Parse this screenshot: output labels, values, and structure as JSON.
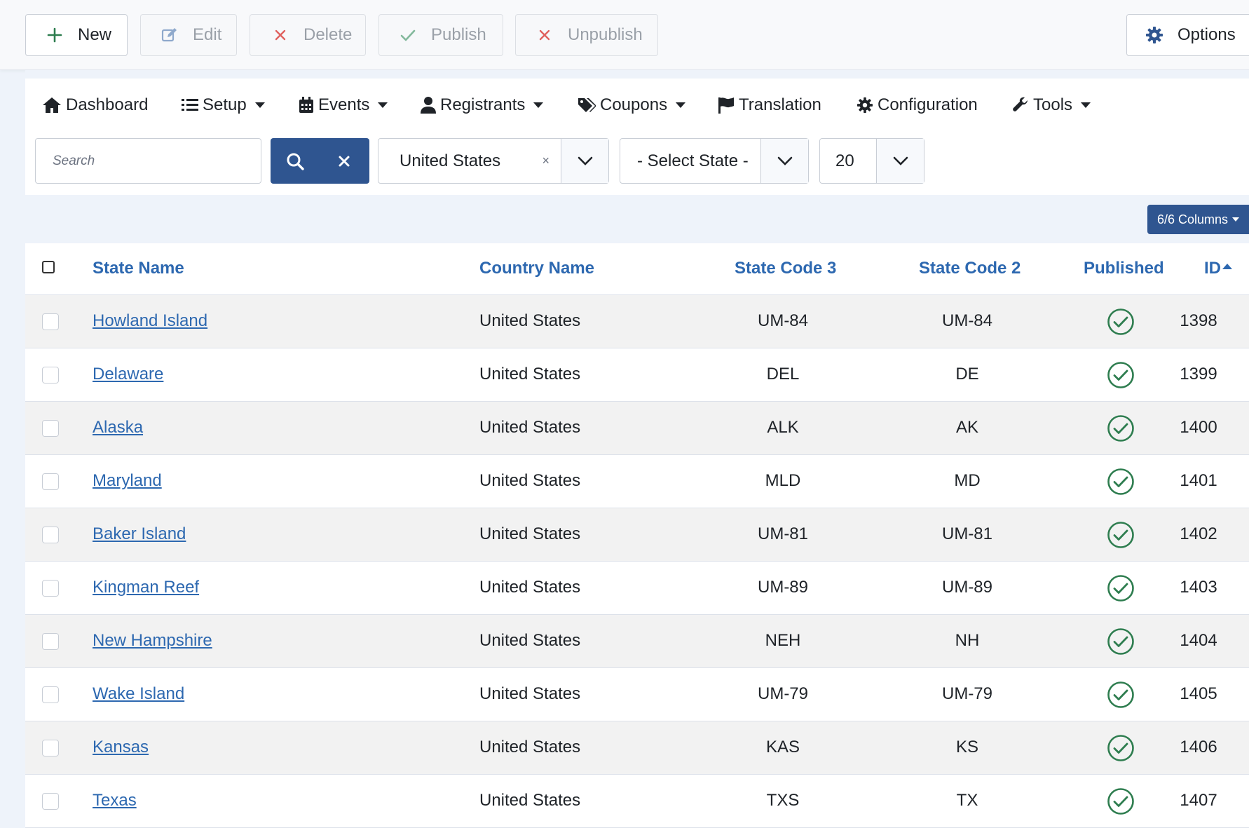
{
  "toolbar": {
    "new_label": "New",
    "edit_label": "Edit",
    "delete_label": "Delete",
    "publish_label": "Publish",
    "unpublish_label": "Unpublish",
    "options_label": "Options"
  },
  "menu": {
    "items": [
      {
        "label": "Dashboard",
        "icon": "home-icon",
        "dropdown": false
      },
      {
        "label": "Setup",
        "icon": "list-icon",
        "dropdown": true
      },
      {
        "label": "Events",
        "icon": "calendar-icon",
        "dropdown": true
      },
      {
        "label": "Registrants",
        "icon": "user-icon",
        "dropdown": true
      },
      {
        "label": "Coupons",
        "icon": "tags-icon",
        "dropdown": true
      },
      {
        "label": "Translation",
        "icon": "flag-icon",
        "dropdown": false
      },
      {
        "label": "Configuration",
        "icon": "gear-icon",
        "dropdown": false
      },
      {
        "label": "Tools",
        "icon": "wrench-icon",
        "dropdown": true
      }
    ]
  },
  "filters": {
    "search_placeholder": "Search",
    "search_value": "",
    "country_value": "United States",
    "country_clear": "×",
    "state_value": "- Select State -",
    "limit_value": "20"
  },
  "columns_button": "6/6 Columns",
  "table": {
    "headers": {
      "state_name": "State Name",
      "country_name": "Country Name",
      "state_code_3": "State Code 3",
      "state_code_2": "State Code 2",
      "published": "Published",
      "id": "ID"
    },
    "sort": {
      "column": "id",
      "direction": "asc"
    },
    "rows": [
      {
        "state_name": "Howland Island",
        "country_name": "United States",
        "state_code_3": "UM-84",
        "state_code_2": "UM-84",
        "published": true,
        "id": "1398"
      },
      {
        "state_name": "Delaware",
        "country_name": "United States",
        "state_code_3": "DEL",
        "state_code_2": "DE",
        "published": true,
        "id": "1399"
      },
      {
        "state_name": "Alaska",
        "country_name": "United States",
        "state_code_3": "ALK",
        "state_code_2": "AK",
        "published": true,
        "id": "1400"
      },
      {
        "state_name": "Maryland",
        "country_name": "United States",
        "state_code_3": "MLD",
        "state_code_2": "MD",
        "published": true,
        "id": "1401"
      },
      {
        "state_name": "Baker Island",
        "country_name": "United States",
        "state_code_3": "UM-81",
        "state_code_2": "UM-81",
        "published": true,
        "id": "1402"
      },
      {
        "state_name": "Kingman Reef",
        "country_name": "United States",
        "state_code_3": "UM-89",
        "state_code_2": "UM-89",
        "published": true,
        "id": "1403"
      },
      {
        "state_name": "New Hampshire",
        "country_name": "United States",
        "state_code_3": "NEH",
        "state_code_2": "NH",
        "published": true,
        "id": "1404"
      },
      {
        "state_name": "Wake Island",
        "country_name": "United States",
        "state_code_3": "UM-79",
        "state_code_2": "UM-79",
        "published": true,
        "id": "1405"
      },
      {
        "state_name": "Kansas",
        "country_name": "United States",
        "state_code_3": "KAS",
        "state_code_2": "KS",
        "published": true,
        "id": "1406"
      },
      {
        "state_name": "Texas",
        "country_name": "United States",
        "state_code_3": "TXS",
        "state_code_2": "TX",
        "published": true,
        "id": "1407"
      }
    ]
  },
  "colors": {
    "primary": "#2f5590",
    "link": "#2d68b0",
    "success": "#2e7d4f",
    "danger": "#e0625f",
    "disabled": "#9aa0a8"
  }
}
